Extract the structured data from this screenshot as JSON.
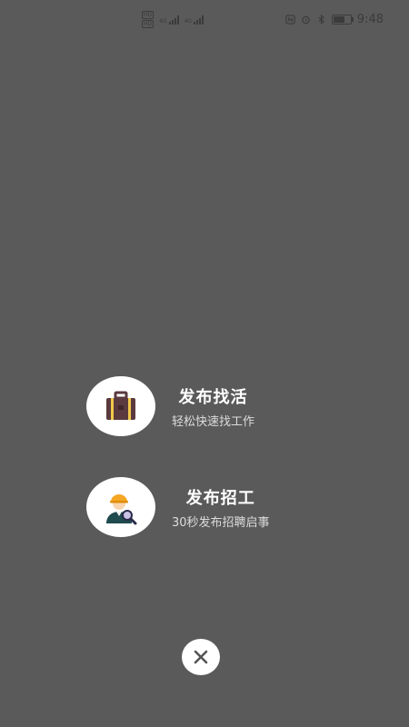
{
  "status_bar": {
    "time": "9:48",
    "hd1": "HD",
    "hd2": "HD",
    "net1": "4G",
    "net2": "4G"
  },
  "options": [
    {
      "title": "发布找活",
      "subtitle": "轻松快速找工作",
      "icon": "briefcase-icon"
    },
    {
      "title": "发布招工",
      "subtitle": "30秒发布招聘启事",
      "icon": "worker-search-icon"
    }
  ],
  "close_button": {
    "icon": "close-icon"
  },
  "colors": {
    "overlay": "#5a5a5a",
    "circle": "#ffffff",
    "briefcase": "#5a3a3e",
    "briefcase_accent": "#f2c84b",
    "helmet": "#f5a623"
  }
}
